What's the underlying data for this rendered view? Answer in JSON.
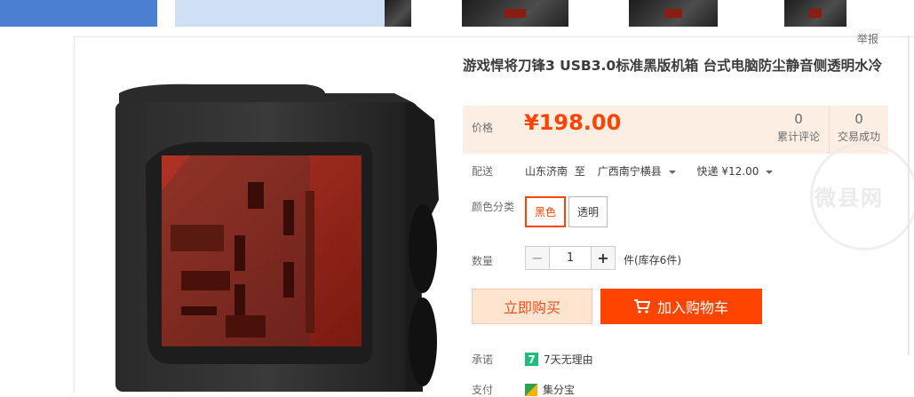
{
  "report_label": "举报",
  "product": {
    "title": "游戏悍将刀锋3 USB3.0标准黑版机箱 台式电脑防尘静音侧透明水冷",
    "price_label": "价格",
    "price": "¥198.00",
    "stats": [
      {
        "count": "0",
        "label": "累计评论"
      },
      {
        "count": "0",
        "label": "交易成功"
      }
    ]
  },
  "shipping": {
    "label": "配送",
    "from": "山东济南",
    "to_word": "至",
    "to": "广西南宁横县",
    "method": "快递 ¥12.00"
  },
  "sku": {
    "label": "颜色分类",
    "options": [
      {
        "label": "黑色",
        "selected": true
      },
      {
        "label": "透明",
        "selected": false
      }
    ]
  },
  "quantity": {
    "label": "数量",
    "value": "1",
    "minus": "−",
    "plus": "+",
    "stock_text": "件(库存6件)"
  },
  "actions": {
    "buy_now": "立即购买",
    "add_to_cart": "加入购物车"
  },
  "promise": {
    "label": "承诺",
    "badge": "7",
    "text": "7天无理由"
  },
  "payment": {
    "label": "支付",
    "text": "集分宝"
  },
  "watermark_text": "微县网",
  "colors": {
    "accent": "#ff4400",
    "price_bg": "#fdeee4",
    "buy_bg": "#ffe4d0"
  },
  "icons": [
    "cart-icon",
    "caret-down-icon",
    "promise-7-icon",
    "pay-icon"
  ]
}
